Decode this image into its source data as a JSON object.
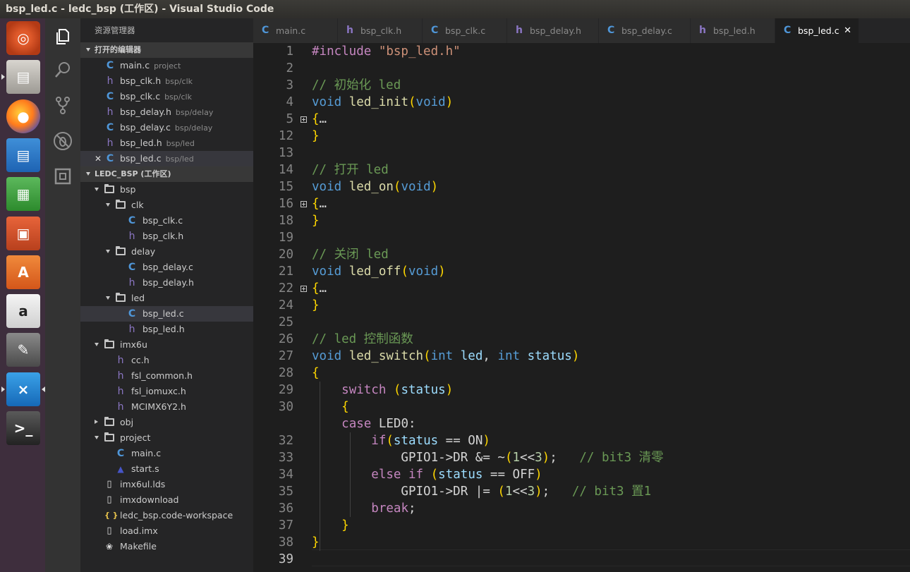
{
  "window": {
    "title": "bsp_led.c - ledc_bsp (工作区) - Visual Studio Code"
  },
  "launcher": {
    "apps": [
      "ubuntu-dash",
      "files",
      "firefox",
      "libreoffice-writer",
      "libreoffice-calc",
      "libreoffice-impress",
      "ubuntu-software",
      "amazon",
      "system-settings",
      "visual-studio-code",
      "terminal"
    ]
  },
  "activity_bar": {
    "icons": [
      "explorer-icon",
      "search-icon",
      "source-control-icon",
      "debug-icon",
      "extensions-icon"
    ]
  },
  "sidebar": {
    "title": "资源管理器",
    "open_editors": {
      "title": "打开的编辑器",
      "items": [
        {
          "icon": "c",
          "name": "main.c",
          "path": "project"
        },
        {
          "icon": "h",
          "name": "bsp_clk.h",
          "path": "bsp/clk"
        },
        {
          "icon": "c",
          "name": "bsp_clk.c",
          "path": "bsp/clk"
        },
        {
          "icon": "h",
          "name": "bsp_delay.h",
          "path": "bsp/delay"
        },
        {
          "icon": "c",
          "name": "bsp_delay.c",
          "path": "bsp/delay"
        },
        {
          "icon": "h",
          "name": "bsp_led.h",
          "path": "bsp/led"
        },
        {
          "icon": "c",
          "name": "bsp_led.c",
          "path": "bsp/led",
          "active": true
        }
      ]
    },
    "workspace": {
      "title": "LEDC_BSP (工作区)",
      "tree": [
        {
          "type": "folder",
          "name": "bsp",
          "depth": 0,
          "open": true
        },
        {
          "type": "folder",
          "name": "clk",
          "depth": 1,
          "open": true
        },
        {
          "type": "c",
          "name": "bsp_clk.c",
          "depth": 2
        },
        {
          "type": "h",
          "name": "bsp_clk.h",
          "depth": 2
        },
        {
          "type": "folder",
          "name": "delay",
          "depth": 1,
          "open": true
        },
        {
          "type": "c",
          "name": "bsp_delay.c",
          "depth": 2
        },
        {
          "type": "h",
          "name": "bsp_delay.h",
          "depth": 2
        },
        {
          "type": "folder",
          "name": "led",
          "depth": 1,
          "open": true
        },
        {
          "type": "c",
          "name": "bsp_led.c",
          "depth": 2,
          "selected": true
        },
        {
          "type": "h",
          "name": "bsp_led.h",
          "depth": 2
        },
        {
          "type": "folder",
          "name": "imx6u",
          "depth": 0,
          "open": true
        },
        {
          "type": "h",
          "name": "cc.h",
          "depth": 1
        },
        {
          "type": "h",
          "name": "fsl_common.h",
          "depth": 1
        },
        {
          "type": "h",
          "name": "fsl_iomuxc.h",
          "depth": 1
        },
        {
          "type": "h",
          "name": "MCIMX6Y2.h",
          "depth": 1
        },
        {
          "type": "folder",
          "name": "obj",
          "depth": 0,
          "open": false
        },
        {
          "type": "folder",
          "name": "project",
          "depth": 0,
          "open": true
        },
        {
          "type": "c",
          "name": "main.c",
          "depth": 1
        },
        {
          "type": "asm",
          "name": "start.s",
          "depth": 1
        },
        {
          "type": "file",
          "name": "imx6ul.lds",
          "depth": 0
        },
        {
          "type": "file",
          "name": "imxdownload",
          "depth": 0
        },
        {
          "type": "json",
          "name": "ledc_bsp.code-workspace",
          "depth": 0
        },
        {
          "type": "file",
          "name": "load.imx",
          "depth": 0
        },
        {
          "type": "make",
          "name": "Makefile",
          "depth": 0
        }
      ]
    }
  },
  "tabs": [
    {
      "icon": "c",
      "label": "main.c"
    },
    {
      "icon": "h",
      "label": "bsp_clk.h"
    },
    {
      "icon": "c",
      "label": "bsp_clk.c"
    },
    {
      "icon": "h",
      "label": "bsp_delay.h"
    },
    {
      "icon": "c",
      "label": "bsp_delay.c"
    },
    {
      "icon": "h",
      "label": "bsp_led.h"
    },
    {
      "icon": "c",
      "label": "bsp_led.c",
      "active": true
    }
  ],
  "editor": {
    "current_line": "39",
    "lines": [
      {
        "n": "1",
        "t": [
          [
            "#include ",
            "kw"
          ],
          [
            "\"bsp_led.h\"",
            "str"
          ]
        ]
      },
      {
        "n": "2",
        "t": []
      },
      {
        "n": "3",
        "t": [
          [
            "// 初始化 led",
            "cm"
          ]
        ]
      },
      {
        "n": "4",
        "t": [
          [
            "void",
            "ty"
          ],
          [
            " ",
            "p"
          ],
          [
            "led_init",
            "fn"
          ],
          [
            "(",
            "br"
          ],
          [
            "void",
            "ty"
          ],
          [
            ")",
            "br"
          ]
        ]
      },
      {
        "n": "5",
        "t": [
          [
            "{",
            "br"
          ],
          [
            "…",
            "p"
          ]
        ],
        "fold": true
      },
      {
        "n": "12",
        "t": [
          [
            "}",
            "br"
          ]
        ]
      },
      {
        "n": "13",
        "t": []
      },
      {
        "n": "14",
        "t": [
          [
            "// 打开 led",
            "cm"
          ]
        ]
      },
      {
        "n": "15",
        "t": [
          [
            "void",
            "ty"
          ],
          [
            " ",
            "p"
          ],
          [
            "led_on",
            "fn"
          ],
          [
            "(",
            "br"
          ],
          [
            "void",
            "ty"
          ],
          [
            ")",
            "br"
          ]
        ]
      },
      {
        "n": "16",
        "t": [
          [
            "{",
            "br"
          ],
          [
            "…",
            "p"
          ]
        ],
        "fold": true
      },
      {
        "n": "18",
        "t": [
          [
            "}",
            "br"
          ]
        ]
      },
      {
        "n": "19",
        "t": []
      },
      {
        "n": "20",
        "t": [
          [
            "// 关闭 led",
            "cm"
          ]
        ]
      },
      {
        "n": "21",
        "t": [
          [
            "void",
            "ty"
          ],
          [
            " ",
            "p"
          ],
          [
            "led_off",
            "fn"
          ],
          [
            "(",
            "br"
          ],
          [
            "void",
            "ty"
          ],
          [
            ")",
            "br"
          ]
        ]
      },
      {
        "n": "22",
        "t": [
          [
            "{",
            "br"
          ],
          [
            "…",
            "p"
          ]
        ],
        "fold": true
      },
      {
        "n": "24",
        "t": [
          [
            "}",
            "br"
          ]
        ]
      },
      {
        "n": "25",
        "t": []
      },
      {
        "n": "26",
        "t": [
          [
            "// led 控制函数",
            "cm"
          ]
        ]
      },
      {
        "n": "27",
        "t": [
          [
            "void",
            "ty"
          ],
          [
            " ",
            "p"
          ],
          [
            "led_switch",
            "fn"
          ],
          [
            "(",
            "br"
          ],
          [
            "int",
            "ty"
          ],
          [
            " ",
            "p"
          ],
          [
            "led",
            "id"
          ],
          [
            ", ",
            "p"
          ],
          [
            "int",
            "ty"
          ],
          [
            " ",
            "p"
          ],
          [
            "status",
            "id"
          ],
          [
            ")",
            "br"
          ]
        ]
      },
      {
        "n": "28",
        "t": [
          [
            "{",
            "br"
          ]
        ]
      },
      {
        "n": "29",
        "t": [
          [
            "    ",
            "p"
          ],
          [
            "switch",
            "kw"
          ],
          [
            " ",
            "p"
          ],
          [
            "(",
            "br"
          ],
          [
            "status",
            "id"
          ],
          [
            ")",
            "br"
          ]
        ]
      },
      {
        "n": "30",
        "t": [
          [
            "    ",
            "p"
          ],
          [
            "{",
            "br"
          ]
        ]
      },
      {
        "n": "",
        "t": [
          [
            "    ",
            "p"
          ],
          [
            "case",
            "kw"
          ],
          [
            " LED0:",
            "p"
          ]
        ]
      },
      {
        "n": "32",
        "t": [
          [
            "        ",
            "p"
          ],
          [
            "if",
            "kw"
          ],
          [
            "(",
            "br"
          ],
          [
            "status",
            "id"
          ],
          [
            " == ON",
            "p"
          ],
          [
            ")",
            "br"
          ]
        ]
      },
      {
        "n": "33",
        "t": [
          [
            "            GPIO1->DR &= ~",
            "p"
          ],
          [
            "(",
            "br"
          ],
          [
            "1",
            "num"
          ],
          [
            "<<",
            "p"
          ],
          [
            "3",
            "num"
          ],
          [
            ")",
            "br"
          ],
          [
            ";   ",
            "p"
          ],
          [
            "// bit3 清零",
            "cm"
          ]
        ]
      },
      {
        "n": "34",
        "t": [
          [
            "        ",
            "p"
          ],
          [
            "else",
            "kw"
          ],
          [
            " ",
            "p"
          ],
          [
            "if",
            "kw"
          ],
          [
            " ",
            "p"
          ],
          [
            "(",
            "br"
          ],
          [
            "status",
            "id"
          ],
          [
            " == OFF",
            "p"
          ],
          [
            ")",
            "br"
          ]
        ]
      },
      {
        "n": "35",
        "t": [
          [
            "            GPIO1->DR |= ",
            "p"
          ],
          [
            "(",
            "br"
          ],
          [
            "1",
            "num"
          ],
          [
            "<<",
            "p"
          ],
          [
            "3",
            "num"
          ],
          [
            ")",
            "br"
          ],
          [
            ";   ",
            "p"
          ],
          [
            "// bit3 置1",
            "cm"
          ]
        ]
      },
      {
        "n": "36",
        "t": [
          [
            "        ",
            "p"
          ],
          [
            "break",
            "kw"
          ],
          [
            ";",
            "p"
          ]
        ]
      },
      {
        "n": "37",
        "t": [
          [
            "    ",
            "p"
          ],
          [
            "}",
            "br"
          ]
        ]
      },
      {
        "n": "38",
        "t": [
          [
            "}",
            "br"
          ]
        ]
      },
      {
        "n": "39",
        "t": []
      }
    ]
  },
  "colors": {
    "kw": "#c586c0",
    "ty": "#569cd6",
    "fn": "#dcdcaa",
    "id": "#9cdcfe",
    "str": "#ce9178",
    "cm": "#6a9955",
    "num": "#b5cea8",
    "br": "#ffd700",
    "p": "#d4d4d4"
  }
}
